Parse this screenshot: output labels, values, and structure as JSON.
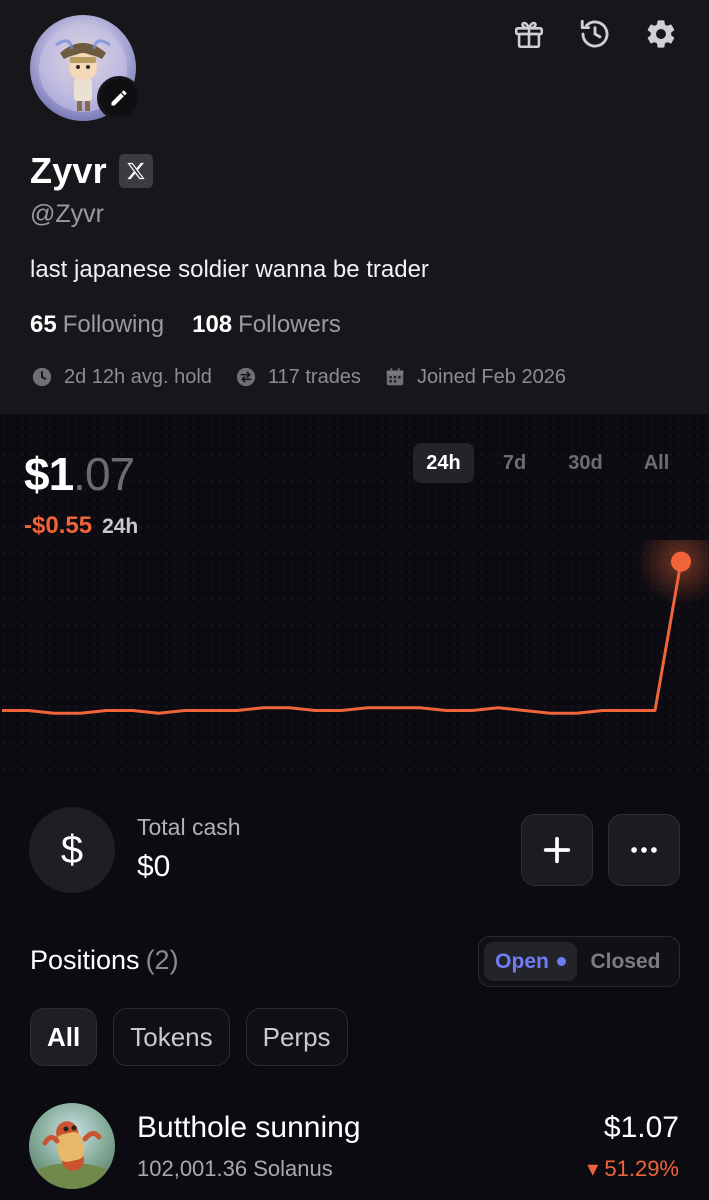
{
  "profile": {
    "name": "Zyvr",
    "handle": "@Zyvr",
    "bio": "last japanese soldier wanna be trader",
    "following_count": "65",
    "following_label": "Following",
    "followers_count": "108",
    "followers_label": "Followers",
    "avg_hold": "2d 12h avg. hold",
    "trades": "117 trades",
    "joined": "Joined Feb 2026",
    "x_badge": "X"
  },
  "icons": {
    "gift": "gift-icon",
    "history": "history-icon",
    "settings": "gear-icon",
    "edit": "pencil-icon"
  },
  "portfolio": {
    "balance_main": "$1",
    "balance_cents": ".07",
    "change_value": "-$0.55",
    "change_period": "24h",
    "ranges": [
      "24h",
      "7d",
      "30d",
      "All"
    ],
    "active_range": "24h",
    "accent_color": "#f0643a"
  },
  "chart_data": {
    "type": "line",
    "series": [
      {
        "values": [
          0.52,
          0.52,
          0.51,
          0.51,
          0.52,
          0.52,
          0.51,
          0.52,
          0.52,
          0.52,
          0.53,
          0.53,
          0.52,
          0.52,
          0.53,
          0.53,
          0.53,
          0.52,
          0.52,
          0.53,
          0.52,
          0.51,
          0.51,
          0.52,
          0.52,
          0.52,
          1.07
        ]
      }
    ],
    "x_count": 27,
    "ylim": [
      0.3,
      1.15
    ],
    "grid": false,
    "color": "#f0643a"
  },
  "cash": {
    "icon_symbol": "$",
    "label": "Total cash",
    "value": "$0",
    "add_button_icon": "plus-icon",
    "more_button_icon": "more-icon"
  },
  "positions": {
    "title": "Positions",
    "count": "(2)",
    "toggle_open": "Open",
    "toggle_closed": "Closed",
    "filters": [
      "All",
      "Tokens",
      "Perps"
    ],
    "items": [
      {
        "name": "Butthole sunning",
        "amount": "102,001.36 Solanus",
        "value": "$1.07",
        "change": "▾ 51.29%"
      }
    ]
  }
}
